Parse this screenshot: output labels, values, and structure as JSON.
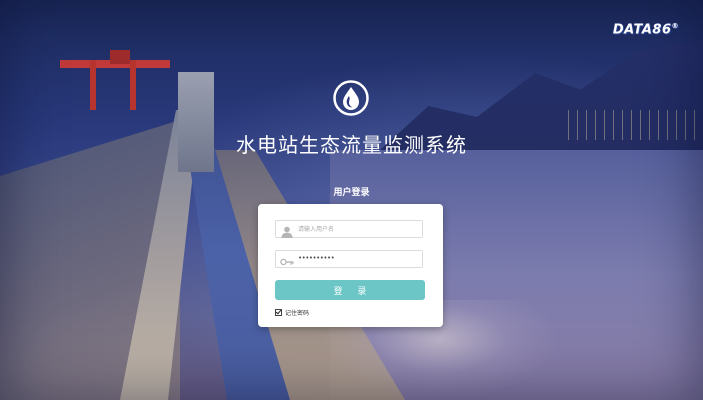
{
  "brand": {
    "name": "DATA86",
    "mark": "®"
  },
  "header": {
    "title": "水电站生态流量监测系统",
    "logo_icon": "water-drop-icon"
  },
  "login": {
    "heading": "用户登录",
    "username": {
      "placeholder": "请输入用户名",
      "value": "",
      "icon": "user-icon"
    },
    "password": {
      "value": "••••••••••",
      "icon": "key-icon"
    },
    "submit_label": "登 录",
    "remember_label": "记住密码",
    "remember_checked": true
  },
  "colors": {
    "accent": "#6cc6c6",
    "card": "#ffffff"
  }
}
